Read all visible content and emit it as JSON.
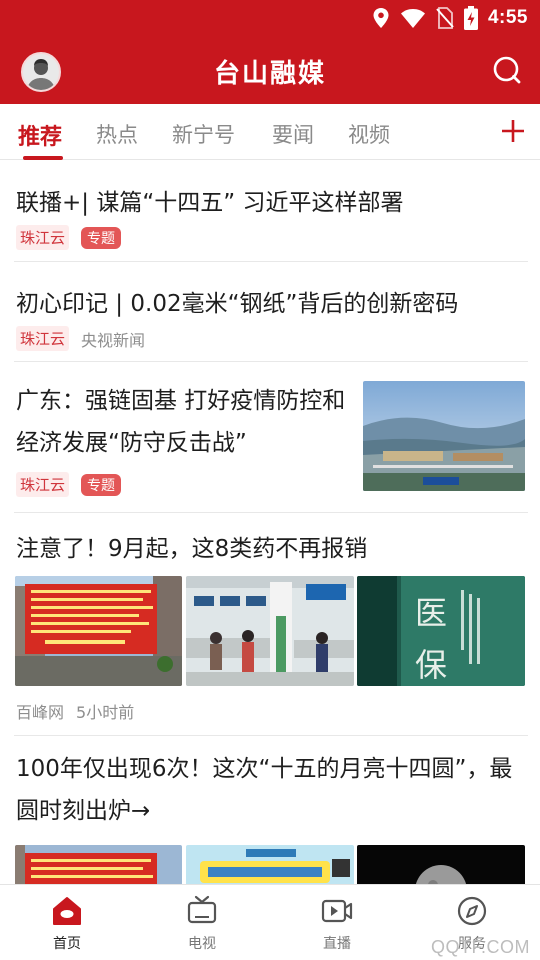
{
  "status_bar": {
    "time": "4:55",
    "icons": [
      "location-icon",
      "wifi-icon",
      "no-sim-icon",
      "battery-charging-icon"
    ]
  },
  "app_bar": {
    "title": "台山融媒",
    "avatar_icon": "user-avatar-icon",
    "search_icon": "search-icon"
  },
  "tabs": {
    "items": [
      {
        "label": "推荐",
        "active": true
      },
      {
        "label": "热点",
        "active": false
      },
      {
        "label": "新宁号",
        "active": false
      },
      {
        "label": "要闻",
        "active": false
      },
      {
        "label": "视频",
        "active": false
      }
    ],
    "add_icon": "plus-icon"
  },
  "feed": [
    {
      "title": "联播+| 谋篇“十四五” 习近平这样部署",
      "source": "珠江云",
      "tag": "专题"
    },
    {
      "title": "初心印记 | 0.02毫米“钢纸”背后的创新密码",
      "source": "珠江云",
      "byline": "央视新闻"
    },
    {
      "title": "广东：强链固基 打好疫情防控和经济发展“防守反击战”",
      "source": "珠江云",
      "tag": "专题",
      "image": "aerial-port-photo"
    },
    {
      "title": "注意了！9月起，这8类药不再报销",
      "source": "百峰网",
      "time": "5小时前",
      "images": [
        "street-banner-photo",
        "hospital-counter-photo",
        "medical-insurance-sign-photo"
      ],
      "image_texts": [
        "医",
        "保"
      ]
    },
    {
      "title": "100年仅出现6次！这次“十五的月亮十四圆”，最圆时刻出炉→",
      "images": [
        "street-banner-photo",
        "poster-photo",
        "moon-photo"
      ]
    }
  ],
  "bottom_nav": {
    "items": [
      {
        "label": "首页",
        "icon": "home-icon",
        "active": true
      },
      {
        "label": "电视",
        "icon": "tv-icon",
        "active": false
      },
      {
        "label": "直播",
        "icon": "live-video-icon",
        "active": false
      },
      {
        "label": "服务",
        "icon": "compass-icon",
        "active": false
      }
    ],
    "watermark": "QQTF.COM"
  },
  "colors": {
    "brand_red": "#c8171e",
    "tag_topic": "#e35656",
    "tag_source_bg": "#fdecec",
    "meta_gray": "#8e8e8e"
  }
}
